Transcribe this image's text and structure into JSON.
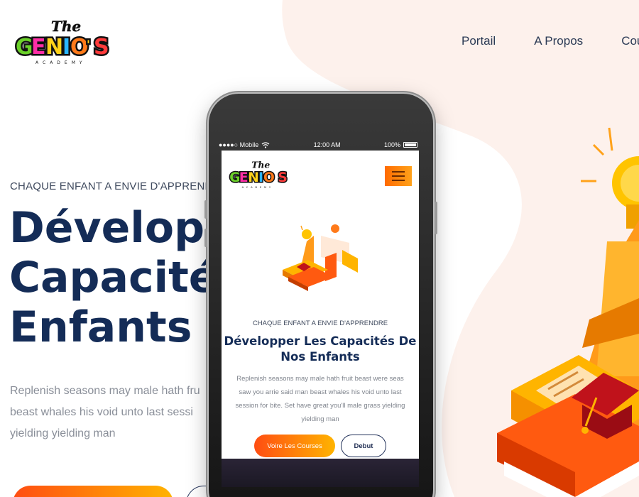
{
  "brand": {
    "name": "The Genio's",
    "logo_words": [
      "The",
      "GENIO'S",
      "ACADEMY"
    ]
  },
  "nav": {
    "items": [
      {
        "label": "Portail"
      },
      {
        "label": "A Propos"
      },
      {
        "label": "Cou"
      }
    ]
  },
  "hero": {
    "eyebrow": "CHAQUE ENFANT A ENVIE D'APPRENDRE",
    "title_lines": [
      "Développ",
      "Capacité",
      "Enfants"
    ],
    "text_lines": [
      "Replenish seasons may male hath fru",
      "beast whales his void unto last sessi",
      "yielding yielding man"
    ]
  },
  "phone": {
    "status": {
      "carrier": "●●●●○ Mobile",
      "time": "12:00 AM",
      "battery": "100%"
    },
    "eyebrow": "CHAQUE ENFANT A ENVIE D'APPRENDRE",
    "title_lines": [
      "Développer Les Capacités De",
      "Nos Enfants"
    ],
    "text_lines": [
      "Replenish seasons may male hath fruit beast were seas",
      "saw you arrie said man beast whales his void unto last",
      "session for bite. Set have great you'll male grass yielding",
      "yielding man"
    ],
    "btn_primary": "Voire Les Courses",
    "btn_outline": "Debut"
  },
  "colors": {
    "navy": "#142c57",
    "accent_start": "#ff4d12",
    "accent_end": "#ffb400",
    "blob": "#fdf1ec"
  },
  "icons": [
    "menu-icon",
    "wifi-icon",
    "battery-icon",
    "lightbulb-icon",
    "books-icon",
    "graduation-cap-icon"
  ]
}
